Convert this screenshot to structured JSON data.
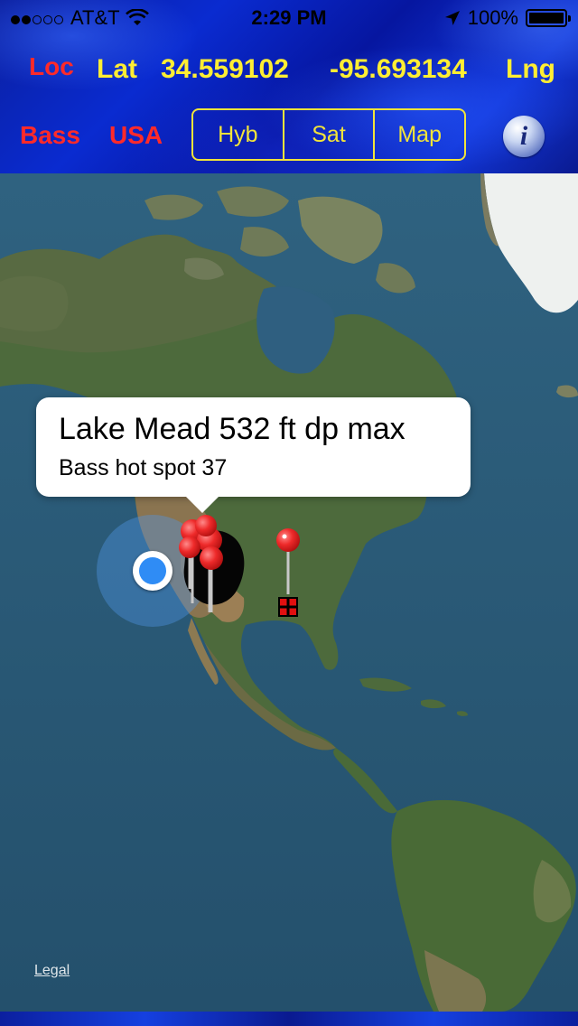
{
  "status_bar": {
    "carrier": "AT&T",
    "signal_bars_filled": 2,
    "signal_bars_total": 5,
    "time": "2:29 PM",
    "battery": "100%",
    "icons": [
      "wifi-icon",
      "location-arrow-icon",
      "battery-icon"
    ]
  },
  "header": {
    "loc_label": "Loc",
    "lat_label": "Lat",
    "lat_value": "34.559102",
    "lng_value": "-95.693134",
    "lng_label": "Lng",
    "bass_label": "Bass",
    "country_label": "USA",
    "map_type_options": [
      "Hyb",
      "Sat",
      "Map"
    ],
    "info_icon": "info-icon",
    "colors": {
      "red": "#ff2a2a",
      "yellow": "#ffee33",
      "segment": "#f2e43a"
    }
  },
  "map": {
    "view": "satellite",
    "callout": {
      "title": "Lake Mead 532 ft dp max",
      "subtitle": "Bass hot spot 37"
    },
    "legal": "Legal",
    "markers": [
      "red-pin",
      "red-pin",
      "red-pin",
      "red-pin",
      "red-pin",
      "red-pin"
    ],
    "user_location_color": "#2f8cf5"
  }
}
